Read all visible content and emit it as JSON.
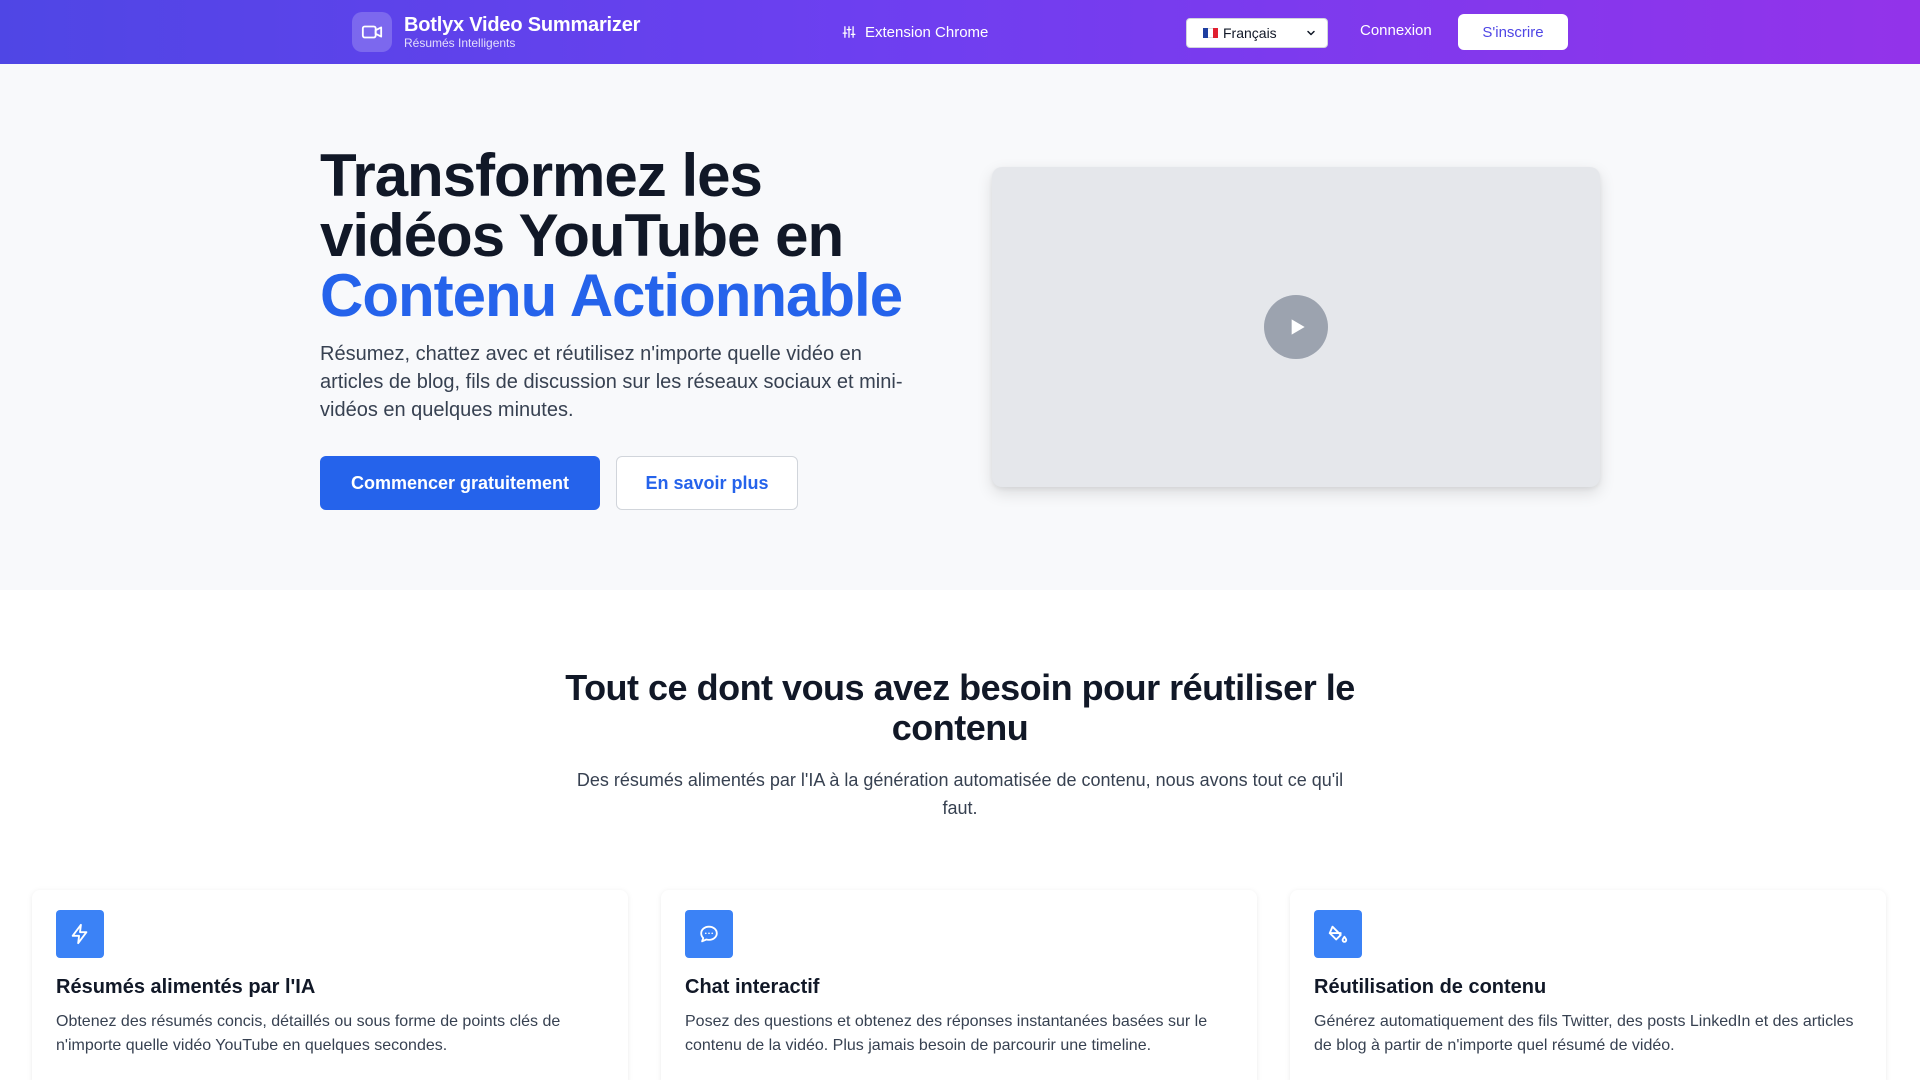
{
  "header": {
    "brand_name": "Botlyx Video Summarizer",
    "brand_tagline": "Résumés Intelligents",
    "extension_link": "Extension Chrome",
    "language": "Français",
    "login": "Connexion",
    "signup": "S'inscrire"
  },
  "hero": {
    "title_line1": "Transformez les",
    "title_line2": "vidéos YouTube en",
    "title_accent": "Contenu Actionnable",
    "subtitle": "Résumez, chattez avec et réutilisez n'importe quelle vidéo en articles de blog, fils de discussion sur les réseaux sociaux et mini-vidéos en quelques minutes.",
    "primary_cta": "Commencer gratuitement",
    "secondary_cta": "En savoir plus"
  },
  "features": {
    "title": "Tout ce dont vous avez besoin pour réutiliser le contenu",
    "subtitle": "Des résumés alimentés par l'IA à la génération automatisée de contenu, nous avons tout ce qu'il faut.",
    "cards": [
      {
        "icon": "lightning-icon",
        "title": "Résumés alimentés par l'IA",
        "text": "Obtenez des résumés concis, détaillés ou sous forme de points clés de n'importe quelle vidéo YouTube en quelques secondes."
      },
      {
        "icon": "chat-bubble-icon",
        "title": "Chat interactif",
        "text": "Posez des questions et obtenez des réponses instantanées basées sur le contenu de la vidéo. Plus jamais besoin de parcourir une timeline."
      },
      {
        "icon": "paint-bucket-icon",
        "title": "Réutilisation de contenu",
        "text": "Générez automatiquement des fils Twitter, des posts LinkedIn et des articles de blog à partir de n'importe quel résumé de vidéo."
      }
    ]
  },
  "colors": {
    "header_gradient_start": "#4f46e5",
    "header_gradient_end": "#9333ea",
    "accent_blue": "#2563eb",
    "icon_blue": "#3b82f6"
  }
}
